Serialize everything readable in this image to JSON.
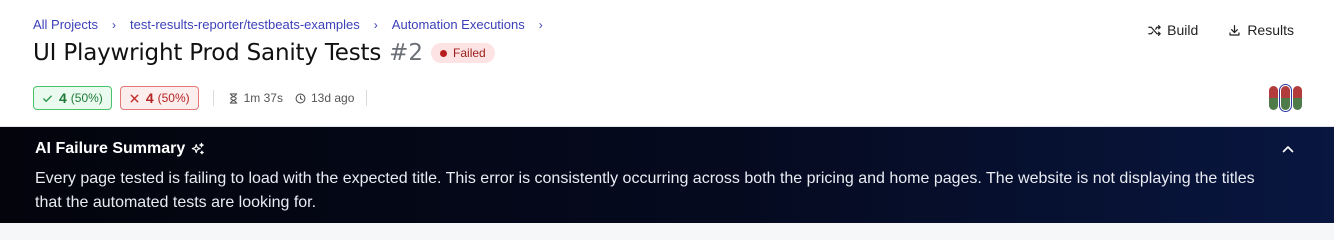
{
  "breadcrumb": {
    "items": [
      "All Projects",
      "test-results-reporter/testbeats-examples",
      "Automation Executions"
    ]
  },
  "page": {
    "title": "UI Playwright Prod Sanity Tests",
    "run_number": "#2",
    "status": "Failed"
  },
  "actions": {
    "build_label": "Build",
    "results_label": "Results"
  },
  "stats": {
    "passed_count": "4",
    "passed_pct": "(50%)",
    "failed_count": "4",
    "failed_pct": "(50%)",
    "duration": "1m 37s",
    "age": "13d ago"
  },
  "history_bars": [
    {
      "fail_fraction": 0.5,
      "selected": false
    },
    {
      "fail_fraction": 0.5,
      "selected": true
    },
    {
      "fail_fraction": 0.5,
      "selected": false
    }
  ],
  "ai_summary": {
    "title": "AI Failure Summary",
    "text": "Every page tested is failing to load with the expected title. This error is consistently occurring across both the pricing and home pages. The website is not displaying the titles that the automated tests are looking for."
  },
  "icons": {
    "build": "shuffle-icon",
    "results": "download-icon",
    "pass": "check-icon",
    "fail": "x-icon",
    "duration": "hourglass-icon",
    "age": "clock-icon",
    "ai": "sparkle-icon",
    "collapse": "chevron-up-icon"
  },
  "colors": {
    "link": "#3b3fb8",
    "pass": "#1e7a3a",
    "fail": "#b42323",
    "bar_fail": "#b23b3b",
    "bar_pass": "#4f7a4a",
    "ai_bg": "#050a1f"
  }
}
